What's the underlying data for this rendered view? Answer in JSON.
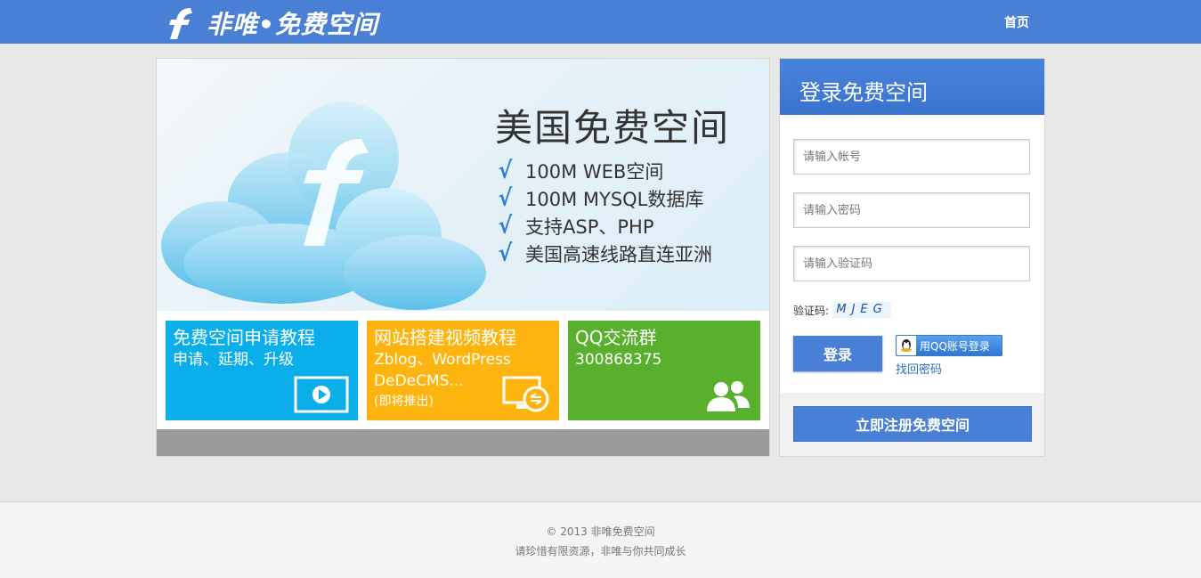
{
  "header": {
    "logo_text": "非唯•免费空间",
    "nav_home": "首页"
  },
  "banner": {
    "title": "美国免费空间",
    "check_mark": "√",
    "features": [
      "100M WEB空间",
      "100M MYSQL数据库",
      "支持ASP、PHP",
      "美国高速线路直连亚洲"
    ]
  },
  "tiles": [
    {
      "title": "免费空间申请教程",
      "subtitle": "申请、延期、升级",
      "color": "#0aaee9",
      "icon": "video-play-icon"
    },
    {
      "title": "网站搭建视频教程",
      "subtitle": "Zblog、WordPress DeDeCMS...",
      "note": "(即将推出)",
      "color": "#fdb40e",
      "icon": "remote-desktop-icon"
    },
    {
      "title": "QQ交流群",
      "subtitle": "300868375",
      "color": "#59b02d",
      "icon": "users-icon"
    }
  ],
  "login": {
    "title": "登录免费空间",
    "account_placeholder": "请输入帐号",
    "password_placeholder": "请输入密码",
    "captcha_placeholder": "请输入验证码",
    "captcha_label": "验证码:",
    "captcha_code": "MJEG",
    "login_button": "登录",
    "qq_login": "用QQ账号登录",
    "forgot_password": "找回密码",
    "register_button": "立即注册免费空间"
  },
  "footer": {
    "copyright": "© 2013 非唯免费空间",
    "slogan": "请珍惜有限资源，非唯与你共同成长"
  },
  "colors": {
    "brand": "#4a7fd6",
    "tile_blue": "#0aaee9",
    "tile_orange": "#fdb40e",
    "tile_green": "#59b02d"
  }
}
